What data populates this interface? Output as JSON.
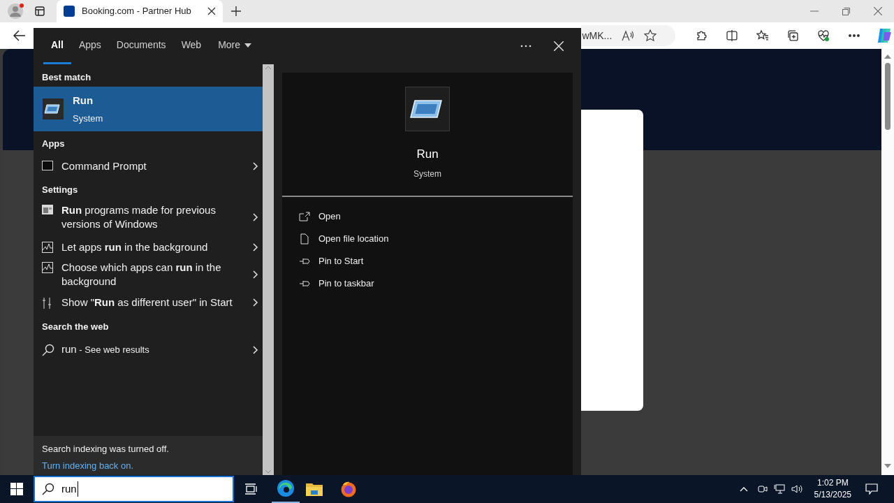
{
  "browser": {
    "tab_title": "Booking.com - Partner Hub",
    "address_text": "wMK..."
  },
  "search": {
    "tabs": [
      {
        "label": "All",
        "selected": true
      },
      {
        "label": "Apps",
        "selected": false
      },
      {
        "label": "Documents",
        "selected": false
      },
      {
        "label": "Web",
        "selected": false
      }
    ],
    "more_label": "More",
    "best_match": {
      "header": "Best match",
      "title": "Run",
      "subtitle": "System",
      "selected": true
    },
    "sections": [
      {
        "header": "Apps",
        "items": [
          {
            "kind": "console",
            "text": "Command Prompt"
          }
        ]
      },
      {
        "header": "Settings",
        "items": [
          {
            "kind": "compat",
            "text": "**Run** programs made for previous versions of Windows"
          },
          {
            "kind": "chart",
            "text": "Let apps **run** in the background"
          },
          {
            "kind": "chart",
            "text": "Choose which apps can **run** in the background"
          },
          {
            "kind": "user",
            "text": "Show \"**Run** as different user\" in Start"
          }
        ]
      },
      {
        "header": "Search the web",
        "items": [
          {
            "kind": "search",
            "text": "run",
            "suffix": " - See web results"
          }
        ]
      }
    ],
    "preview": {
      "title": "Run",
      "subtitle": "System",
      "actions": [
        {
          "kind": "open",
          "label": "Open"
        },
        {
          "kind": "folder",
          "label": "Open file location"
        },
        {
          "kind": "pin",
          "label": "Pin to Start"
        },
        {
          "kind": "pin",
          "label": "Pin to taskbar"
        }
      ]
    },
    "notice": {
      "text": "Search indexing was turned off.",
      "link": "Turn indexing back on."
    },
    "query": "run"
  },
  "clock": {
    "time": "1:02 PM",
    "date": "5/13/2025"
  }
}
